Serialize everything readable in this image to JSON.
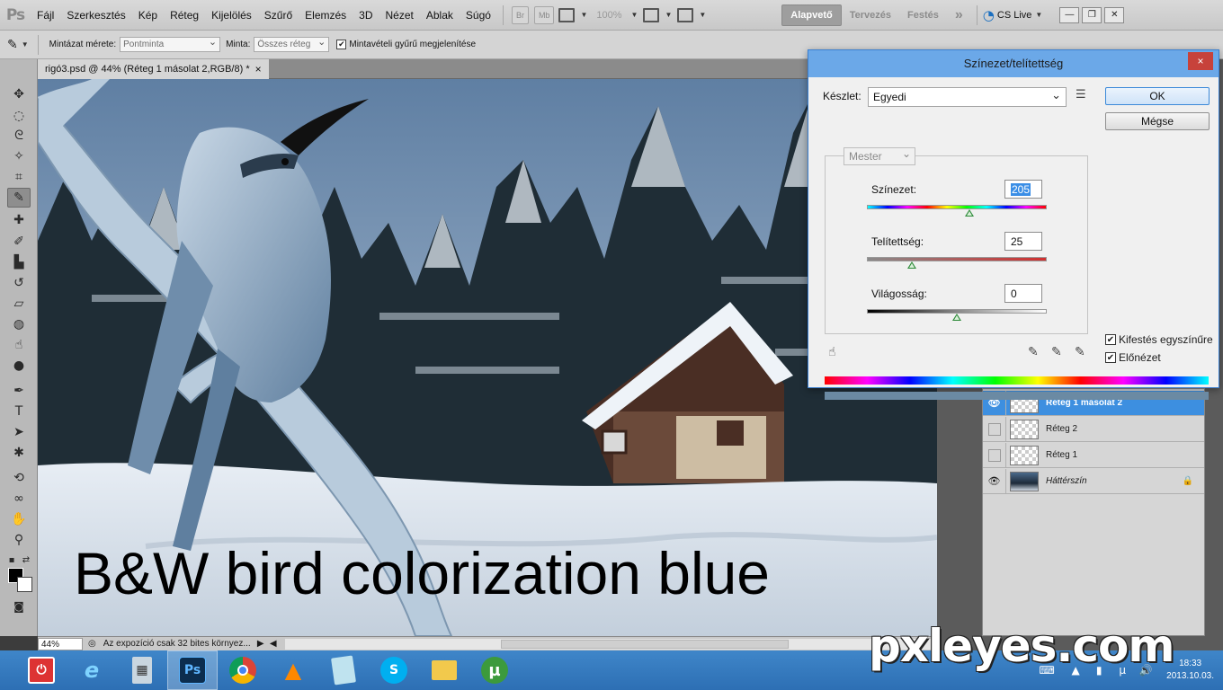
{
  "app": {
    "logo": "Ps",
    "menu": [
      "Fájl",
      "Szerkesztés",
      "Kép",
      "Réteg",
      "Kijelölés",
      "Szűrő",
      "Elemzés",
      "3D",
      "Nézet",
      "Ablak",
      "Súgó"
    ],
    "menubar_buttons": [
      "Br",
      "Mb"
    ],
    "zoom_display": "100%",
    "workspaces": [
      "Alapvető",
      "Tervezés",
      "Festés"
    ],
    "more_workspaces": "»",
    "cs_live": "CS Live"
  },
  "options_bar": {
    "sample_size_label": "Mintázat mérete:",
    "sample_size_value": "Pontminta",
    "sample_label": "Minta:",
    "sample_value": "Összes réteg",
    "show_ring_label": "Mintavételi gyűrű megjelenítése",
    "show_ring_checked": true
  },
  "document": {
    "tab_title": "rigó3.psd @ 44% (Réteg 1 másolat 2,RGB/8) *",
    "close_glyph": "×",
    "caption": "B&W bird  colorization  blue"
  },
  "statusbar": {
    "zoom": "44%",
    "message": "Az expozíció csak 32 bites környez..."
  },
  "dialog": {
    "title": "Színezet/telítettség",
    "close": "×",
    "preset_label": "Készlet:",
    "preset_value": "Egyedi",
    "ok": "OK",
    "cancel": "Mégse",
    "channel": "Mester",
    "hue_label": "Színezet:",
    "hue_value": "205",
    "saturation_label": "Telítettség:",
    "saturation_value": "25",
    "lightness_label": "Világosság:",
    "lightness_value": "0",
    "hue_slider_fraction": 0.57,
    "saturation_slider_fraction": 0.25,
    "lightness_slider_fraction": 0.5,
    "colorize_label": "Kifestés egyszínűre",
    "colorize_checked": true,
    "preview_label": "Előnézet",
    "preview_checked": true
  },
  "layers": [
    {
      "name": "Réteg 1 másolat 2",
      "visible": true,
      "selected": true,
      "type": "layer"
    },
    {
      "name": "Réteg 2",
      "visible": false,
      "selected": false,
      "type": "layer"
    },
    {
      "name": "Réteg 1",
      "visible": false,
      "selected": false,
      "type": "layer"
    },
    {
      "name": "Háttérszín",
      "visible": true,
      "selected": false,
      "type": "background"
    }
  ],
  "taskbar": {
    "apps": [
      "power",
      "internet-explorer",
      "calculator",
      "photoshop",
      "chrome",
      "vlc",
      "notepad",
      "skype",
      "file-explorer",
      "utorrent"
    ],
    "photoshop_label": "Ps",
    "skype_label": "S",
    "utorrent_label": "µ",
    "time": "18:33",
    "date": "2013.10.03."
  },
  "watermark": "pxleyes.com",
  "colors": {
    "selection_blue": "#3d8fe0",
    "dialog_title": "#6ba8e8",
    "taskbar": "#2d6fb4"
  }
}
